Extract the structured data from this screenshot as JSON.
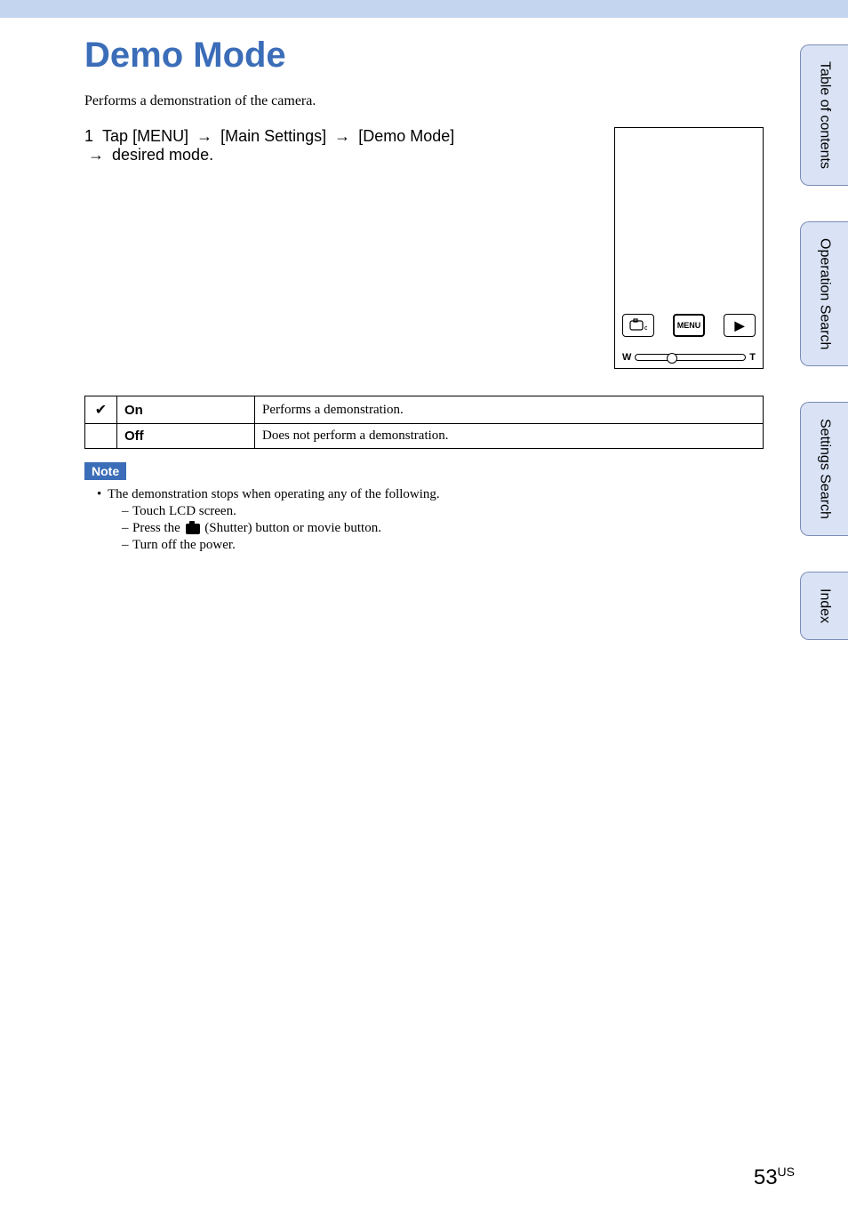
{
  "title": "Demo Mode",
  "intro": "Performs a demonstration of the camera.",
  "step": {
    "number": "1",
    "prefix": "Tap ",
    "parts": [
      "[MENU]",
      "[Main Settings]",
      "[Demo Mode]",
      "desired mode."
    ]
  },
  "illustration": {
    "menu_label": "MENU",
    "zoom_w": "W",
    "zoom_t": "T"
  },
  "options": [
    {
      "selected": true,
      "name": "On",
      "desc": "Performs a demonstration."
    },
    {
      "selected": false,
      "name": "Off",
      "desc": "Does not perform a demonstration."
    }
  ],
  "note": {
    "label": "Note",
    "main": "The demonstration stops when operating any of the following.",
    "sub": [
      "Touch LCD screen.",
      {
        "pre": "Press the ",
        "post": " (Shutter) button or movie button."
      },
      "Turn off the power."
    ]
  },
  "side_tabs": [
    "Table of contents",
    "Operation Search",
    "Settings Search",
    "Index"
  ],
  "page": {
    "num": "53",
    "suffix": "US"
  }
}
